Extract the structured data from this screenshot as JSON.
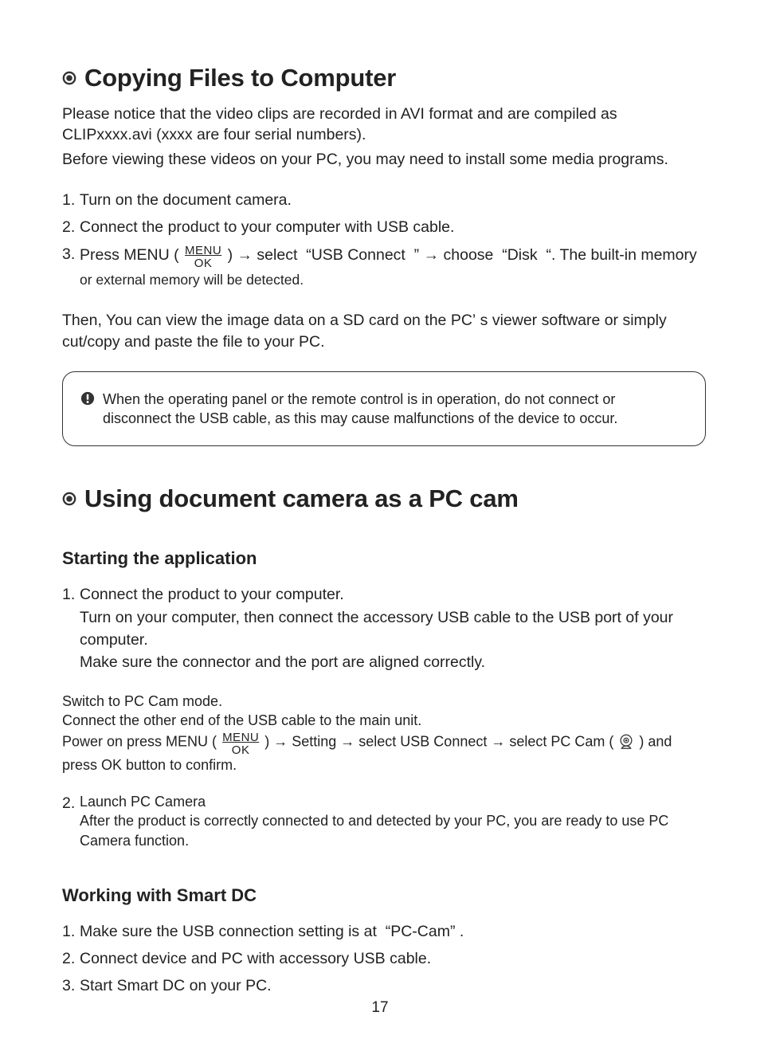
{
  "section1": {
    "title": "Copying Files to Computer",
    "intro1": "Please notice that the video clips are recorded in AVI format and are compiled as CLIPxxxx.avi (xxxx are four serial numbers).",
    "intro2": "Before viewing these videos on your PC, you may need to install some media programs.",
    "steps": {
      "n1": "1.",
      "s1": "Turn on the document camera.",
      "n2": "2.",
      "s2": "Connect the product to your computer with USB cable.",
      "n3": "3.",
      "s3a": "Press MENU ( ",
      "s3b": " ) → select  “USB Connect  ” → choose  “Disk  “. The built-in memory",
      "s3c": "or external memory will be detected."
    },
    "then": "Then, You can view the image data on a SD card on the PC’ s viewer software or simply cut/copy and paste the file to your PC.",
    "callout": "When the operating panel or the remote control is in operation, do not connect or disconnect the USB cable, as this may cause malfunctions of the device to occur."
  },
  "menuok": {
    "top": "MENU",
    "bot": "OK"
  },
  "section2": {
    "title": "Using document camera as a PC cam",
    "h3a": "Starting the application",
    "step1": {
      "n": "1.",
      "l1": "Connect the product to your computer.",
      "l2": "Turn on your computer, then connect the accessory USB cable to the USB port of your computer.",
      "l3": "Make sure the connector and the port are aligned correctly."
    },
    "switch": {
      "l1": "Switch to PC Cam mode.",
      "l2": "Connect the other end of the USB cable to the main unit.",
      "l3a": "Power on press MENU ( ",
      "l3b": " ) → Setting → select USB Connect → select PC Cam ( ",
      "l3c": " ) and",
      "l4": "press OK button to confirm."
    },
    "step2": {
      "n": "2.",
      "l1": "Launch PC Camera",
      "l2": "After the product is correctly connected to and detected by your PC, you are ready to use PC Camera function."
    },
    "h3b": "Working with Smart DC",
    "smartdc": {
      "n1": "1.",
      "s1": "Make sure the USB connection setting is at  “PC-Cam” .",
      "n2": "2.",
      "s2": "Connect device and PC with accessory USB cable.",
      "n3": "3.",
      "s3": "Start Smart DC on your PC."
    }
  },
  "page_number": "17"
}
